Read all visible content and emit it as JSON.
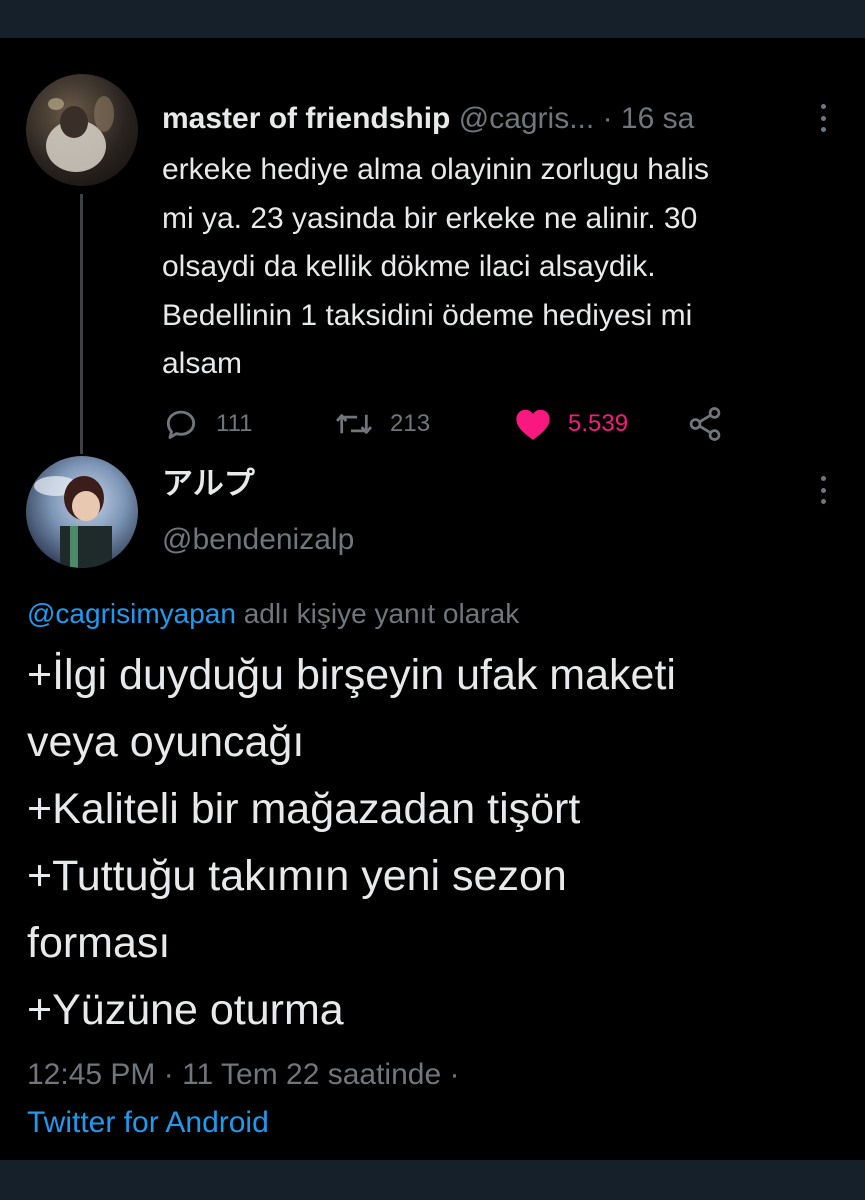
{
  "original_tweet": {
    "display_name": "master of friendship",
    "handle": "@cagris...",
    "separator": "·",
    "time": "16 sa",
    "text": "erkeke hediye alma olayinin zorlugu halis\nmi ya. 23 yasinda bir erkeke ne alinir. 30\nolsaydi da kellik dökme ilaci alsaydik.\nBedellinin 1 taksidini ödeme hediyesi mi\nalsam",
    "actions": {
      "reply_count": "111",
      "retweet_count": "213",
      "like_count": "5.539",
      "liked": true
    }
  },
  "reply_tweet": {
    "display_name": "アルプ",
    "handle": "@bendenizalp",
    "reply_to_mention": "@cagrisimyapan",
    "reply_to_suffix": " adlı kişiye yanıt olarak",
    "text": "+İlgi duyduğu birşeyin ufak maketi\nveya oyuncağı\n+Kaliteli bir mağazadan tişört\n+Tuttuğu takımın yeni sezon\nforması\n+Yüzüne oturma",
    "timestamp": "12:45 PM · 11 Tem 22 saatinde ·",
    "source": "Twitter for Android"
  },
  "icons": {
    "reply": "comment-bubble-icon",
    "retweet": "retweet-arrows-icon",
    "like": "heart-icon",
    "share": "share-nodes-icon",
    "more": "more-vertical-icon"
  },
  "colors": {
    "background": "#000000",
    "outer_band": "#15202b",
    "primary_text": "#e7e9ea",
    "secondary_text": "#71767b",
    "accent_blue": "#1d9bf0",
    "like_pink": "#f91880"
  }
}
